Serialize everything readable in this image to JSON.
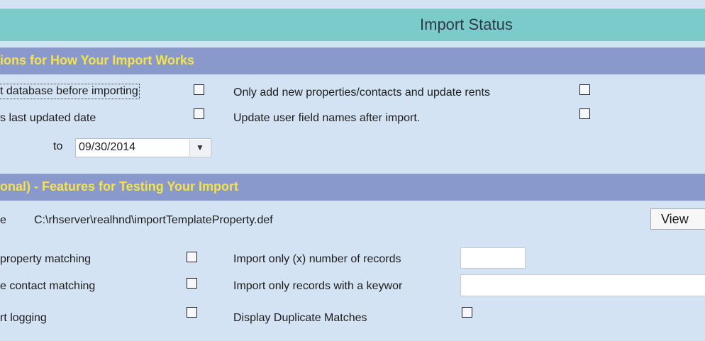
{
  "header": {
    "title": "Import Status"
  },
  "section1": {
    "title": "ions for How Your Import Works",
    "opt_backup": "t database before importing",
    "opt_new_only": "Only add new properties/contacts and update rents",
    "opt_last_updated": "s last updated date",
    "opt_update_fields": "Update user field names after import.",
    "to_label": "to",
    "to_date": "09/30/2014"
  },
  "section2": {
    "title": "onal) - Features for Testing Your Import",
    "file_label": "e",
    "file_path": "C:\\rhserver\\realhnd\\importTemplateProperty.def",
    "view_button": "View",
    "opt_property_matching": "property matching",
    "opt_import_count": "Import only (x) number of records",
    "opt_contact_matching": "e contact matching",
    "opt_keyword": "Import only records with a keywor",
    "opt_logging": "rt logging",
    "opt_duplicates": "Display Duplicate Matches"
  },
  "icons": {
    "dropdown": "chevron-down-icon"
  }
}
